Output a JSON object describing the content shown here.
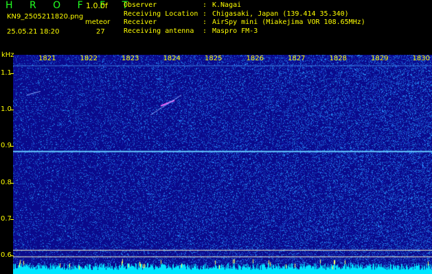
{
  "header": {
    "title": "H R O F F T",
    "version": "1.0.0f",
    "file_name": "KN9_2505211820.png",
    "meteor_label": "meteor",
    "date_time": "25.05.21 18:20",
    "meteor_count": "27"
  },
  "meta": [
    {
      "key": "Observer",
      "value": "K.Nagai"
    },
    {
      "key": "Receiving Location",
      "value": "Chigasaki, Japan (139.414 35.340)"
    },
    {
      "key": "Receiver",
      "value": "AirSpy mini (Miakejima VOR 108.65MHz)"
    },
    {
      "key": "Receiving antenna",
      "value": "Maspro FM-3"
    }
  ],
  "y_axis": {
    "unit": "kHz",
    "labels": [
      "1.1",
      "1.0",
      "0.9",
      "0.8",
      "0.7",
      "0.6"
    ]
  },
  "x_axis": {
    "labels": [
      "1821",
      "1822",
      "1823",
      "1824",
      "1825",
      "1826",
      "1827",
      "1828",
      "1829",
      "1830"
    ]
  },
  "colors": {
    "background": "#0a0a8c",
    "text": "#ffff00",
    "title": "#22ff22",
    "carrier": "#66ccff",
    "noise_floor": "#00e5ff",
    "meteor": "#ff66ff"
  },
  "plot": {
    "y_max_khz": 1.15,
    "y_min_khz": 0.55,
    "carrier_khz": [
      0.885,
      1.12
    ],
    "reference_line_khz": [
      0.615,
      0.597
    ]
  }
}
